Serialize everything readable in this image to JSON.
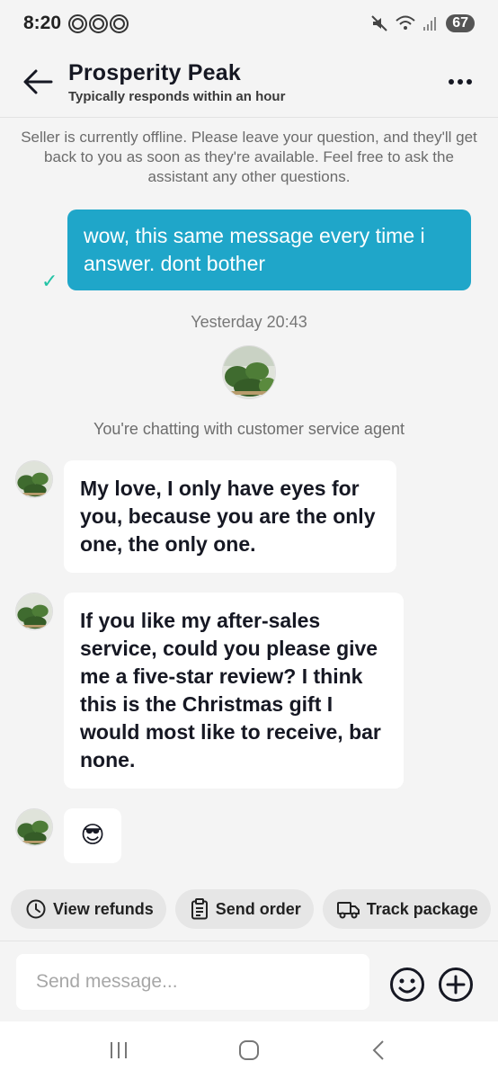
{
  "status_bar": {
    "time": "8:20",
    "battery": "67",
    "icons": [
      "threads-icon",
      "threads-icon",
      "threads-icon",
      "mute-icon",
      "wifi-icon",
      "signal-icon",
      "battery-icon"
    ]
  },
  "header": {
    "shop_name": "Prosperity Peak",
    "response_time": "Typically responds within an hour"
  },
  "notice": "Seller is currently offline. Please leave your question, and they'll get back to you as soon as they're available. Feel free to ask the assistant any other questions.",
  "messages": [
    {
      "from": "me",
      "text": "wow, this same message every time i answer. dont bother",
      "status": "sent"
    },
    {
      "from": "agent",
      "text": "My love, I only have eyes for you, because you are the only one, the only one."
    },
    {
      "from": "agent",
      "text": "If you like my after-sales service, could you please give me a five-star review? I think this is the Christmas gift I would most like to receive, bar none."
    },
    {
      "from": "agent",
      "text": "😎"
    }
  ],
  "timestamp": "Yesterday 20:43",
  "system_note": "You're chatting with customer service agent",
  "quick_actions": [
    {
      "label": "View refunds",
      "icon": "clock-icon"
    },
    {
      "label": "Send order",
      "icon": "clipboard-icon"
    },
    {
      "label": "Track package",
      "icon": "truck-icon"
    }
  ],
  "composer": {
    "placeholder": "Send message..."
  },
  "colors": {
    "accent": "#1fa6c9",
    "check": "#22c3a5",
    "background": "#f4f4f4"
  }
}
